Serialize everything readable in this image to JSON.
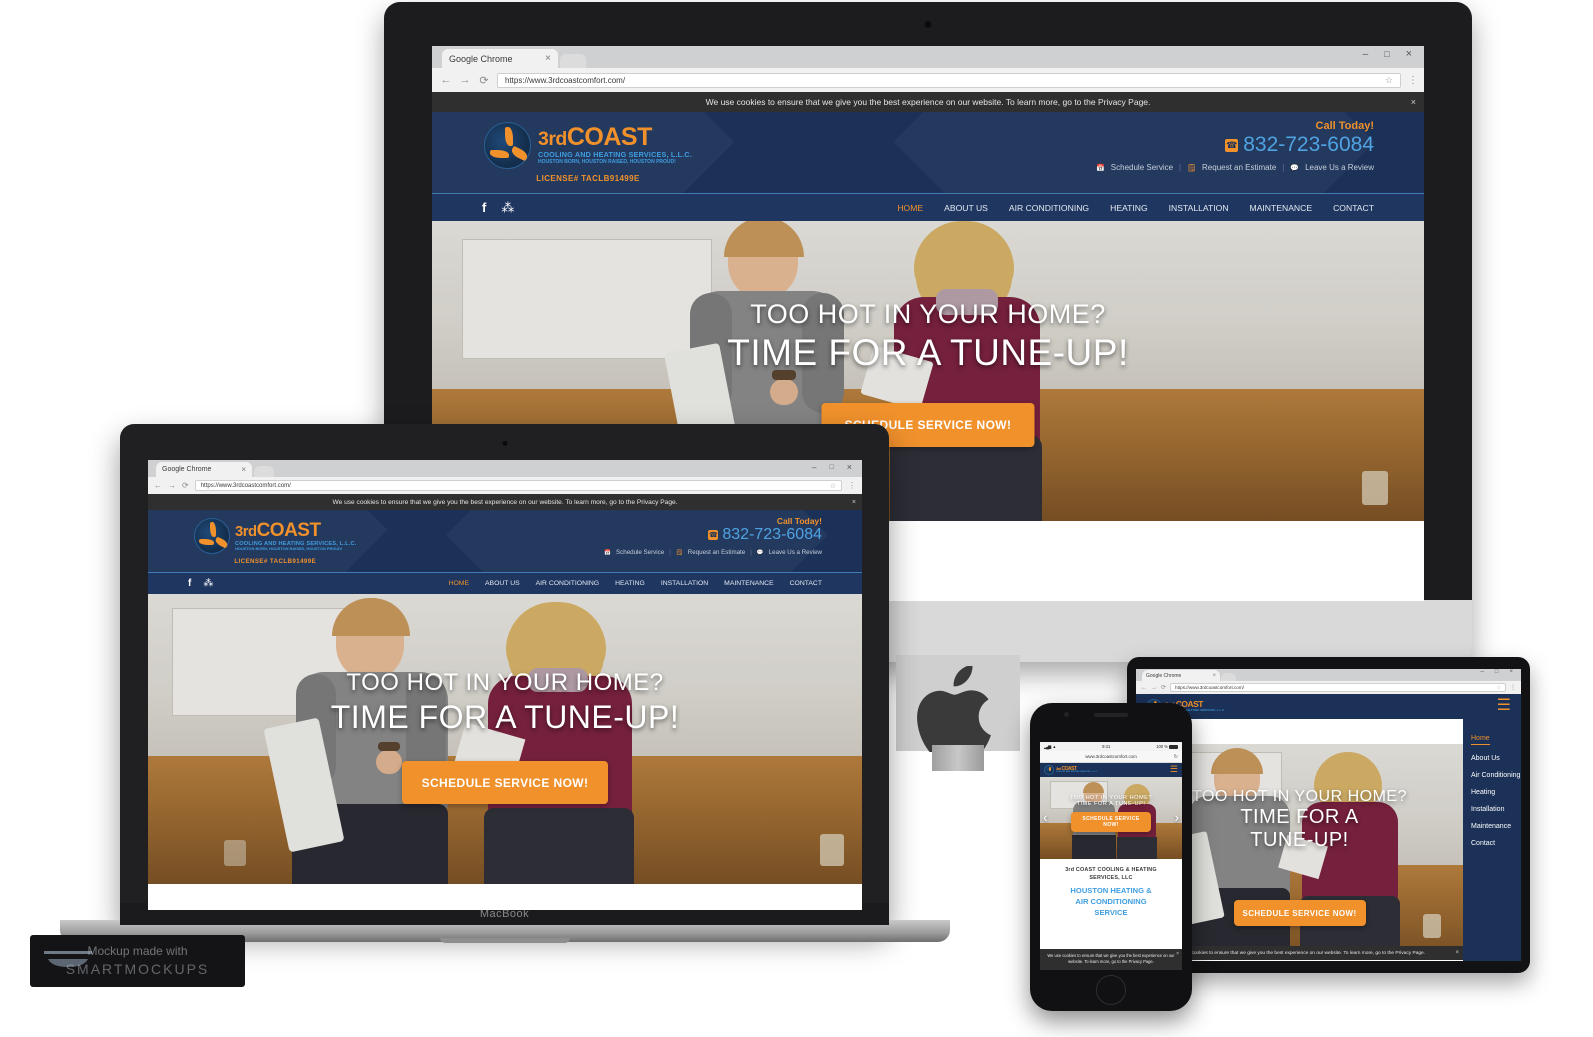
{
  "mockup": {
    "watermark_line1": "Mockup made with",
    "watermark_line2": "SMARTMOCKUPS",
    "macbook_label": "MacBook"
  },
  "browser": {
    "tab_title": "Google Chrome",
    "tab_close": "×",
    "url": "https://www.3rdcoastcomfort.com/",
    "back_icon": "←",
    "forward_icon": "→",
    "reload_icon": "⟳",
    "star_icon": "☆",
    "menu_icon": "⋮",
    "minimize": "–",
    "maximize": "□",
    "close": "×"
  },
  "cookie": {
    "text": "We use cookies to ensure that we give you the best experience on our website. To learn more, go to the Privacy Page.",
    "close": "×"
  },
  "site": {
    "logo": {
      "brand_prefix": "3rd",
      "brand_main": "COAST",
      "subtitle": "COOLING AND HEATING SERVICES, L.L.C.",
      "tagline": "HOUSTON BORN, HOUSTON RAISED, HOUSTON PROUD!",
      "license": "LICENSE# TACLB91499E"
    },
    "contact": {
      "call_today": "Call Today!",
      "phone": "832-723-6084",
      "phone_icon": "☎"
    },
    "utility_links": [
      {
        "icon": "📅",
        "label": "Schedule Service"
      },
      {
        "icon": "🗒",
        "label": "Request an Estimate"
      },
      {
        "icon": "💬",
        "label": "Leave Us a Review"
      }
    ],
    "social": [
      {
        "icon": "f",
        "name": "facebook-icon"
      },
      {
        "icon": "⁂",
        "name": "yelp-icon"
      }
    ],
    "menu": [
      {
        "label": "HOME",
        "active": true
      },
      {
        "label": "ABOUT US",
        "active": false
      },
      {
        "label": "AIR CONDITIONING",
        "active": false
      },
      {
        "label": "HEATING",
        "active": false
      },
      {
        "label": "INSTALLATION",
        "active": false
      },
      {
        "label": "MAINTENANCE",
        "active": false
      },
      {
        "label": "CONTACT",
        "active": false
      }
    ],
    "hero": {
      "line1": "TOO HOT IN YOUR HOME?",
      "line2": "TIME FOR A TUNE-UP!",
      "line2_mobile_a": "TIME FOR A",
      "line2_mobile_b": "TUNE-UP!",
      "cta": "SCHEDULE SERVICE NOW!",
      "cta_mobile_a": "SCHEDULE SERVICE",
      "cta_mobile_b": "NOW!",
      "prev_arrow": "‹",
      "next_arrow": "›"
    },
    "intro": {
      "eyebrow_line1": "3rd COAST COOLING & HEATING",
      "eyebrow_line2": "SERVICES, LLC",
      "headline_line1": "HOUSTON HEATING &",
      "headline_line2": "AIR CONDITIONING",
      "headline_line3": "SERVICE"
    },
    "hamburger_icon": "☰"
  },
  "phone": {
    "status_time": "9:41",
    "status_battery": "100 %",
    "signal_icon": "▂▄▆",
    "wifi_icon": "▲",
    "url": "www.3rdcoastcomfort.com",
    "reload_icon": "↻",
    "cookie_text": "We use cookies to ensure that we give you the best experience on our website. To learn more, go to the Privacy Page.",
    "cookie_close": "×"
  },
  "tablet_menu": [
    "Home",
    "About Us",
    "Air Conditioning",
    "Heating",
    "Installation",
    "Maintenance",
    "Contact"
  ],
  "colors": {
    "brand_orange": "#f0912c",
    "brand_blue": "#1b3157",
    "link_blue": "#4fa3e3",
    "nav_blue": "#1e3660",
    "cookie_bg": "#2f2f2f"
  }
}
